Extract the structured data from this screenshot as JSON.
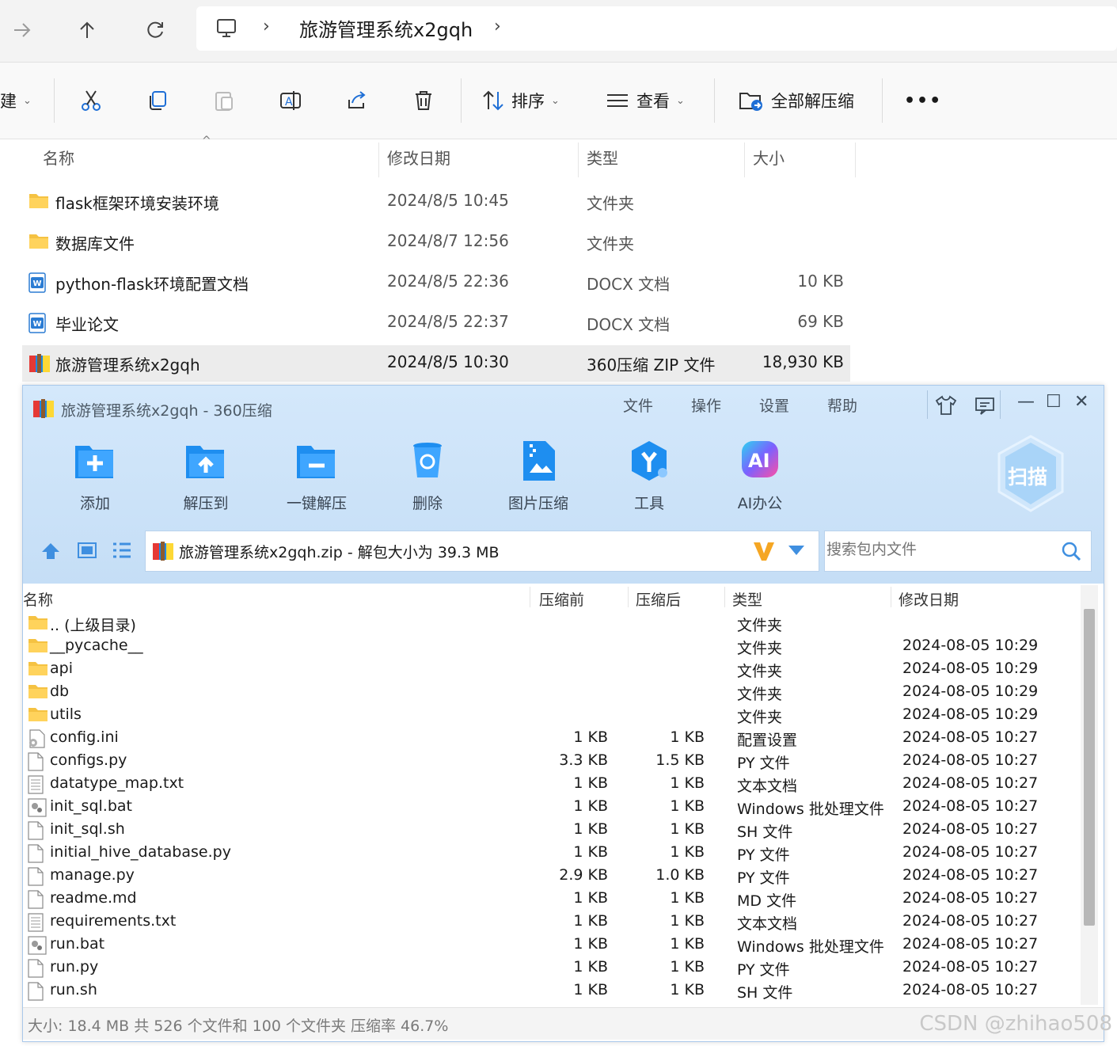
{
  "explorer": {
    "nav": {
      "forward_icon": "arrow-right-icon",
      "up_icon": "arrow-up-icon",
      "refresh_icon": "refresh-icon"
    },
    "breadcrumb": {
      "root_icon": "this-pc-icon",
      "folder": "旅游管理系统x2gqh"
    },
    "commands": {
      "new_label_fragment": "建",
      "sort_label": "排序",
      "view_label": "查看",
      "extract_all_label": "全部解压缩",
      "more_label": "•••"
    },
    "columns": {
      "name": "名称",
      "modified": "修改日期",
      "type": "类型",
      "size": "大小"
    },
    "files": [
      {
        "name": "flask框架环境安装环境",
        "modified": "2024/8/5 10:45",
        "type": "文件夹",
        "size": "",
        "icon": "folder-icon"
      },
      {
        "name": "数据库文件",
        "modified": "2024/8/7 12:56",
        "type": "文件夹",
        "size": "",
        "icon": "folder-icon"
      },
      {
        "name": "python-flask环境配置文档",
        "modified": "2024/8/5 22:36",
        "type": "DOCX 文档",
        "size": "10 KB",
        "icon": "word-doc-icon"
      },
      {
        "name": "毕业论文",
        "modified": "2024/8/5 22:37",
        "type": "DOCX 文档",
        "size": "69 KB",
        "icon": "word-doc-icon"
      },
      {
        "name": "旅游管理系统x2gqh",
        "modified": "2024/8/5 10:30",
        "type": "360压缩 ZIP 文件",
        "size": "18,930 KB",
        "icon": "zip-archive-icon"
      }
    ]
  },
  "zip": {
    "title": "旅游管理系统x2gqh - 360压缩",
    "menu": [
      "文件",
      "操作",
      "设置",
      "帮助"
    ],
    "tools": [
      {
        "label": "添加",
        "icon": "add-folder-icon"
      },
      {
        "label": "解压到",
        "icon": "extract-to-icon"
      },
      {
        "label": "一键解压",
        "icon": "one-click-extract-icon"
      },
      {
        "label": "删除",
        "icon": "delete-bin-icon"
      },
      {
        "label": "图片压缩",
        "icon": "image-compress-icon"
      },
      {
        "label": "工具",
        "icon": "tools-icon"
      },
      {
        "label": "AI办公",
        "icon": "ai-office-icon"
      }
    ],
    "scan_label": "扫描",
    "path_text": "旅游管理系统x2gqh.zip - 解包大小为 39.3 MB",
    "search_placeholder": "搜索包内文件",
    "columns": {
      "name": "名称",
      "before": "压缩前",
      "after": "压缩后",
      "type": "类型",
      "modified": "修改日期"
    },
    "entries": [
      {
        "name": ".. (上级目录)",
        "before": "",
        "after": "",
        "type": "文件夹",
        "modified": "",
        "icon": "folder-icon"
      },
      {
        "name": "__pycache__",
        "before": "",
        "after": "",
        "type": "文件夹",
        "modified": "2024-08-05 10:29",
        "icon": "folder-icon"
      },
      {
        "name": "api",
        "before": "",
        "after": "",
        "type": "文件夹",
        "modified": "2024-08-05 10:29",
        "icon": "folder-icon"
      },
      {
        "name": "db",
        "before": "",
        "after": "",
        "type": "文件夹",
        "modified": "2024-08-05 10:29",
        "icon": "folder-icon"
      },
      {
        "name": "utils",
        "before": "",
        "after": "",
        "type": "文件夹",
        "modified": "2024-08-05 10:29",
        "icon": "folder-icon"
      },
      {
        "name": "config.ini",
        "before": "1 KB",
        "after": "1 KB",
        "type": "配置设置",
        "modified": "2024-08-05 10:27",
        "icon": "config-file-icon"
      },
      {
        "name": "configs.py",
        "before": "3.3 KB",
        "after": "1.5 KB",
        "type": "PY 文件",
        "modified": "2024-08-05 10:27",
        "icon": "file-icon"
      },
      {
        "name": "datatype_map.txt",
        "before": "1 KB",
        "after": "1 KB",
        "type": "文本文档",
        "modified": "2024-08-05 10:27",
        "icon": "text-file-icon"
      },
      {
        "name": "init_sql.bat",
        "before": "1 KB",
        "after": "1 KB",
        "type": "Windows 批处理文件",
        "modified": "2024-08-05 10:27",
        "icon": "batch-file-icon"
      },
      {
        "name": "init_sql.sh",
        "before": "1 KB",
        "after": "1 KB",
        "type": "SH 文件",
        "modified": "2024-08-05 10:27",
        "icon": "file-icon"
      },
      {
        "name": "initial_hive_database.py",
        "before": "1 KB",
        "after": "1 KB",
        "type": "PY 文件",
        "modified": "2024-08-05 10:27",
        "icon": "file-icon"
      },
      {
        "name": "manage.py",
        "before": "2.9 KB",
        "after": "1.0 KB",
        "type": "PY 文件",
        "modified": "2024-08-05 10:27",
        "icon": "file-icon"
      },
      {
        "name": "readme.md",
        "before": "1 KB",
        "after": "1 KB",
        "type": "MD 文件",
        "modified": "2024-08-05 10:27",
        "icon": "file-icon"
      },
      {
        "name": "requirements.txt",
        "before": "1 KB",
        "after": "1 KB",
        "type": "文本文档",
        "modified": "2024-08-05 10:27",
        "icon": "text-file-icon"
      },
      {
        "name": "run.bat",
        "before": "1 KB",
        "after": "1 KB",
        "type": "Windows 批处理文件",
        "modified": "2024-08-05 10:27",
        "icon": "batch-file-icon"
      },
      {
        "name": "run.py",
        "before": "1 KB",
        "after": "1 KB",
        "type": "PY 文件",
        "modified": "2024-08-05 10:27",
        "icon": "file-icon"
      },
      {
        "name": "run.sh",
        "before": "1 KB",
        "after": "1 KB",
        "type": "SH 文件",
        "modified": "2024-08-05 10:27",
        "icon": "file-icon"
      }
    ],
    "status": "大小: 18.4 MB 共 526 个文件和 100 个文件夹 压缩率 46.7%"
  },
  "watermark": "CSDN @zhihao508",
  "colors": {
    "zip_header_bg": "#d4e8fb",
    "tool_icon_blue": "#1e8ef0",
    "selected_row": "#ececec"
  }
}
